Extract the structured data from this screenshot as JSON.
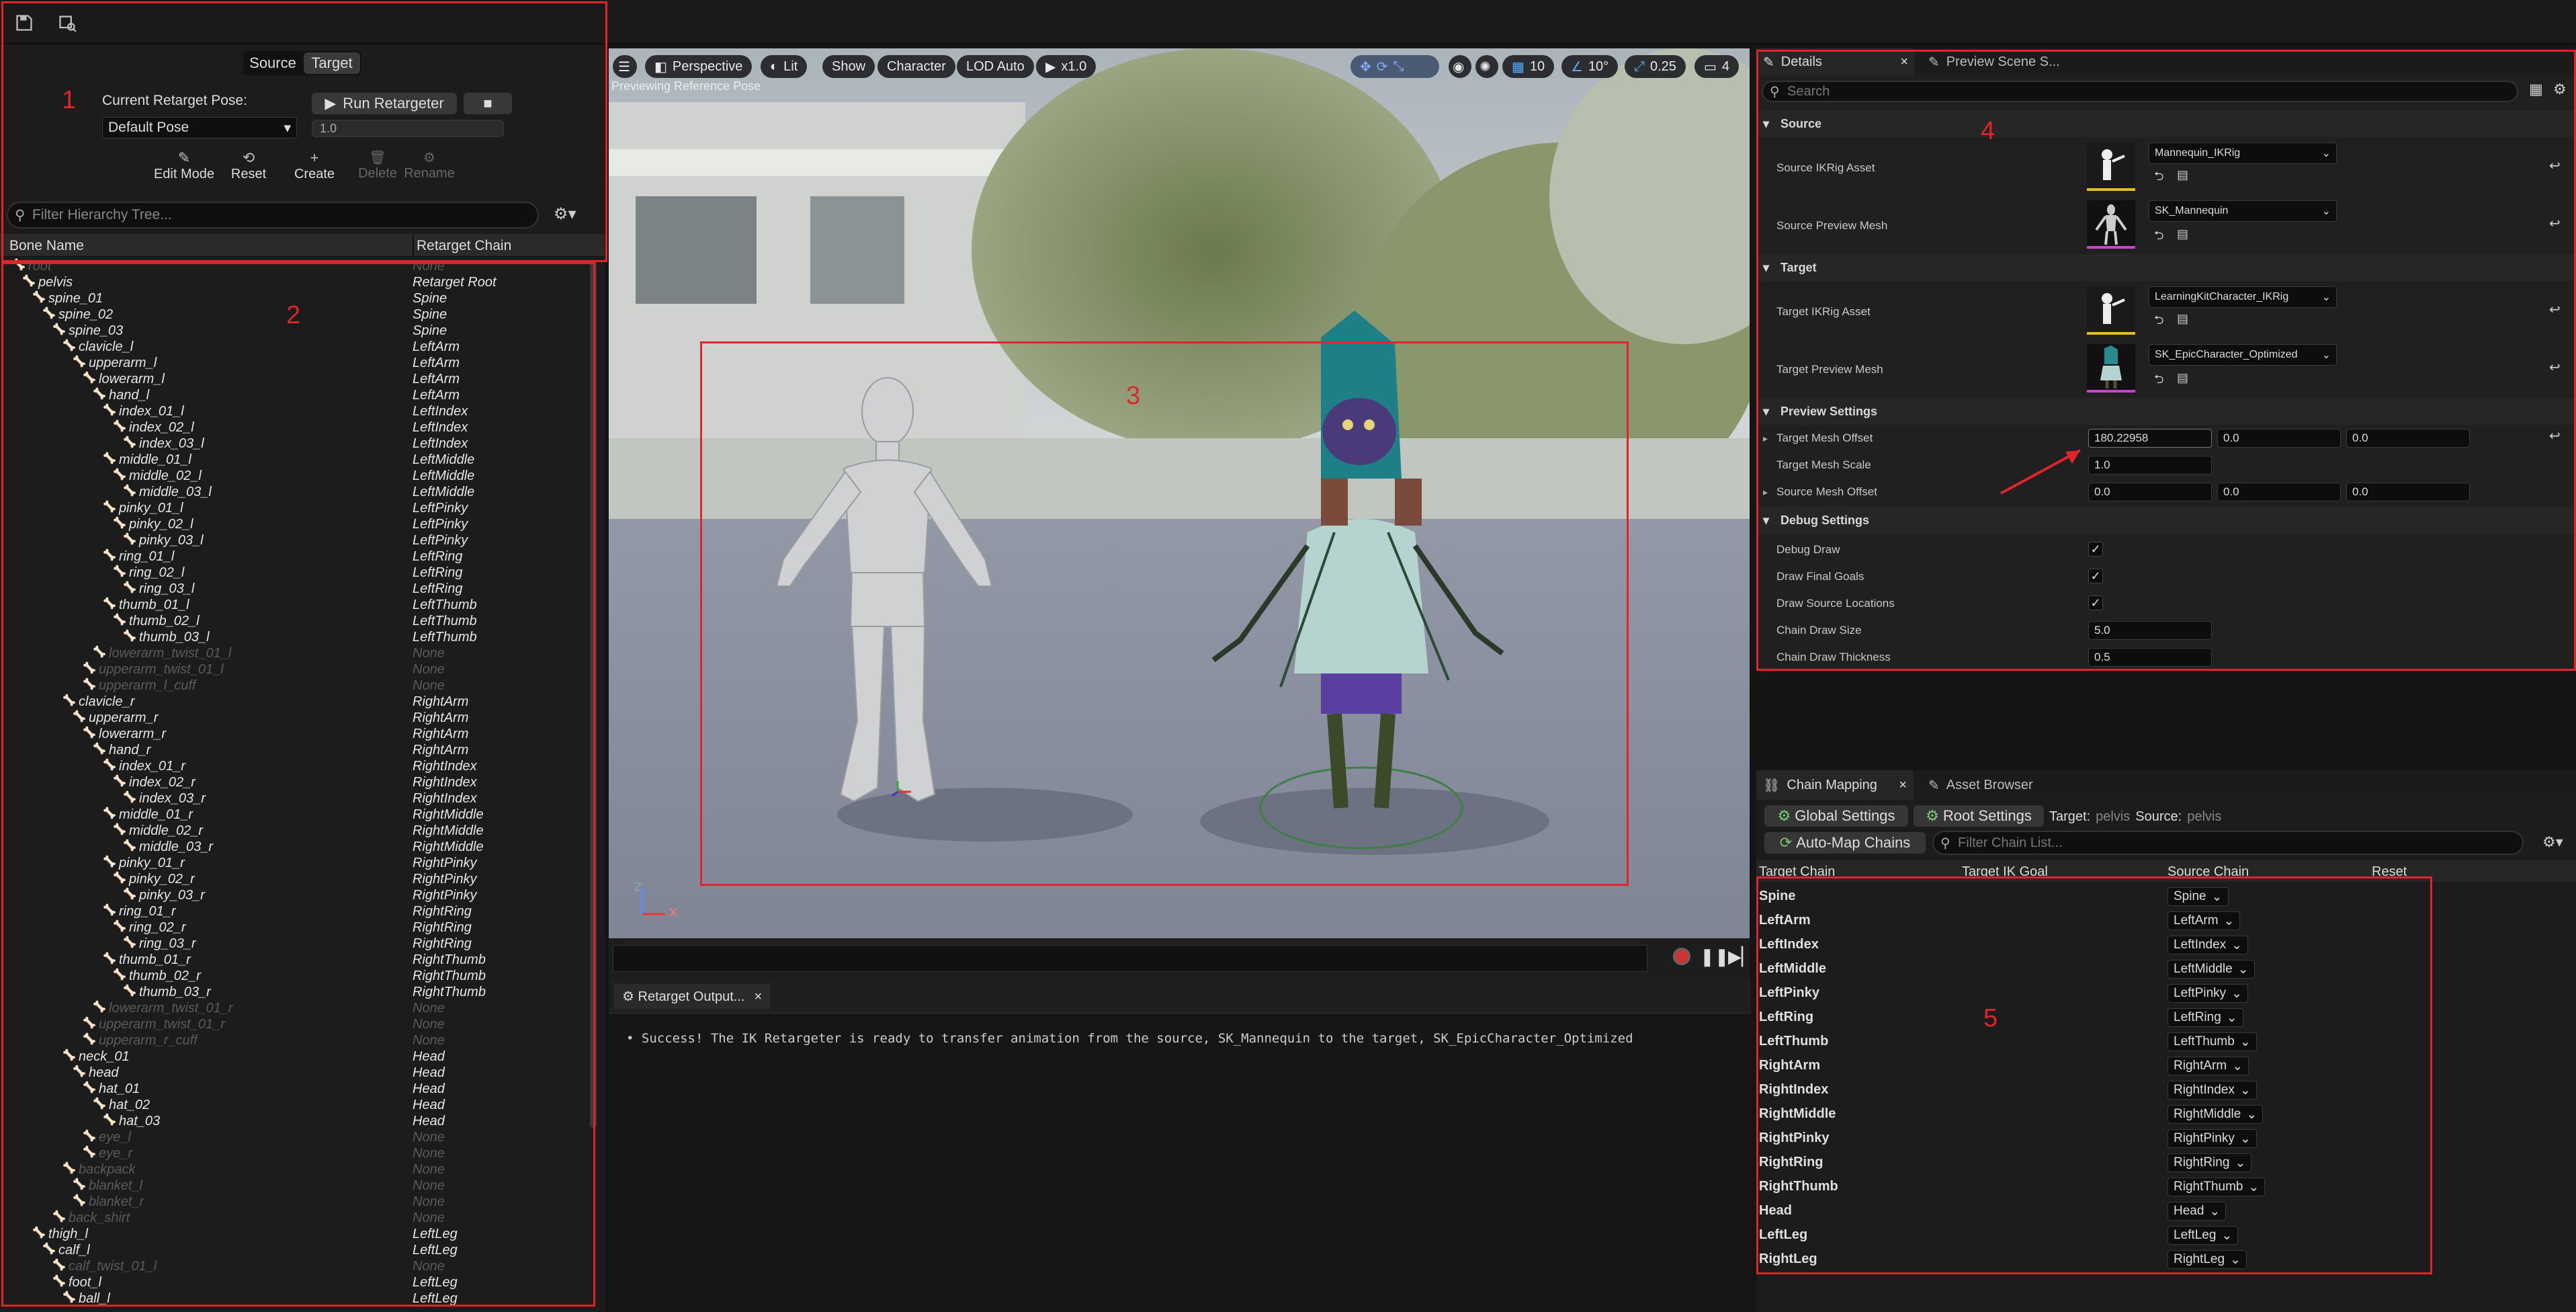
{
  "toolbar": {
    "save_icon": "save-icon",
    "browse_icon": "browse-asset-icon"
  },
  "retarget_panel": {
    "tab_source": "Source",
    "tab_target": "Target",
    "pose_label": "Current Retarget Pose:",
    "run_label": "Run Retargeter",
    "pose_value": "Default Pose",
    "blend_value": "1.0",
    "edit_mode": "Edit Mode",
    "reset": "Reset",
    "create": "Create",
    "delete": "Delete",
    "rename": "Rename",
    "filter_placeholder": "Filter Hierarchy Tree...",
    "col_bone": "Bone Name",
    "col_chain": "Retarget Chain"
  },
  "annotations": {
    "one": "1",
    "two": "2",
    "three": "3",
    "four": "4",
    "five": "5"
  },
  "bones": [
    {
      "name": "root",
      "chain": "None",
      "depth": 0,
      "dim": true
    },
    {
      "name": "pelvis",
      "chain": "Retarget Root",
      "depth": 1,
      "dim": false
    },
    {
      "name": "spine_01",
      "chain": "Spine",
      "depth": 2,
      "dim": false
    },
    {
      "name": "spine_02",
      "chain": "Spine",
      "depth": 3,
      "dim": false
    },
    {
      "name": "spine_03",
      "chain": "Spine",
      "depth": 4,
      "dim": false
    },
    {
      "name": "clavicle_l",
      "chain": "LeftArm",
      "depth": 5,
      "dim": false
    },
    {
      "name": "upperarm_l",
      "chain": "LeftArm",
      "depth": 6,
      "dim": false
    },
    {
      "name": "lowerarm_l",
      "chain": "LeftArm",
      "depth": 7,
      "dim": false
    },
    {
      "name": "hand_l",
      "chain": "LeftArm",
      "depth": 8,
      "dim": false
    },
    {
      "name": "index_01_l",
      "chain": "LeftIndex",
      "depth": 9,
      "dim": false
    },
    {
      "name": "index_02_l",
      "chain": "LeftIndex",
      "depth": 10,
      "dim": false
    },
    {
      "name": "index_03_l",
      "chain": "LeftIndex",
      "depth": 11,
      "dim": false
    },
    {
      "name": "middle_01_l",
      "chain": "LeftMiddle",
      "depth": 9,
      "dim": false
    },
    {
      "name": "middle_02_l",
      "chain": "LeftMiddle",
      "depth": 10,
      "dim": false
    },
    {
      "name": "middle_03_l",
      "chain": "LeftMiddle",
      "depth": 11,
      "dim": false
    },
    {
      "name": "pinky_01_l",
      "chain": "LeftPinky",
      "depth": 9,
      "dim": false
    },
    {
      "name": "pinky_02_l",
      "chain": "LeftPinky",
      "depth": 10,
      "dim": false
    },
    {
      "name": "pinky_03_l",
      "chain": "LeftPinky",
      "depth": 11,
      "dim": false
    },
    {
      "name": "ring_01_l",
      "chain": "LeftRing",
      "depth": 9,
      "dim": false
    },
    {
      "name": "ring_02_l",
      "chain": "LeftRing",
      "depth": 10,
      "dim": false
    },
    {
      "name": "ring_03_l",
      "chain": "LeftRing",
      "depth": 11,
      "dim": false
    },
    {
      "name": "thumb_01_l",
      "chain": "LeftThumb",
      "depth": 9,
      "dim": false
    },
    {
      "name": "thumb_02_l",
      "chain": "LeftThumb",
      "depth": 10,
      "dim": false
    },
    {
      "name": "thumb_03_l",
      "chain": "LeftThumb",
      "depth": 11,
      "dim": false
    },
    {
      "name": "lowerarm_twist_01_l",
      "chain": "None",
      "depth": 8,
      "dim": true
    },
    {
      "name": "upperarm_twist_01_l",
      "chain": "None",
      "depth": 7,
      "dim": true
    },
    {
      "name": "upperarm_l_cuff",
      "chain": "None",
      "depth": 7,
      "dim": true
    },
    {
      "name": "clavicle_r",
      "chain": "RightArm",
      "depth": 5,
      "dim": false
    },
    {
      "name": "upperarm_r",
      "chain": "RightArm",
      "depth": 6,
      "dim": false
    },
    {
      "name": "lowerarm_r",
      "chain": "RightArm",
      "depth": 7,
      "dim": false
    },
    {
      "name": "hand_r",
      "chain": "RightArm",
      "depth": 8,
      "dim": false
    },
    {
      "name": "index_01_r",
      "chain": "RightIndex",
      "depth": 9,
      "dim": false
    },
    {
      "name": "index_02_r",
      "chain": "RightIndex",
      "depth": 10,
      "dim": false
    },
    {
      "name": "index_03_r",
      "chain": "RightIndex",
      "depth": 11,
      "dim": false
    },
    {
      "name": "middle_01_r",
      "chain": "RightMiddle",
      "depth": 9,
      "dim": false
    },
    {
      "name": "middle_02_r",
      "chain": "RightMiddle",
      "depth": 10,
      "dim": false
    },
    {
      "name": "middle_03_r",
      "chain": "RightMiddle",
      "depth": 11,
      "dim": false
    },
    {
      "name": "pinky_01_r",
      "chain": "RightPinky",
      "depth": 9,
      "dim": false
    },
    {
      "name": "pinky_02_r",
      "chain": "RightPinky",
      "depth": 10,
      "dim": false
    },
    {
      "name": "pinky_03_r",
      "chain": "RightPinky",
      "depth": 11,
      "dim": false
    },
    {
      "name": "ring_01_r",
      "chain": "RightRing",
      "depth": 9,
      "dim": false
    },
    {
      "name": "ring_02_r",
      "chain": "RightRing",
      "depth": 10,
      "dim": false
    },
    {
      "name": "ring_03_r",
      "chain": "RightRing",
      "depth": 11,
      "dim": false
    },
    {
      "name": "thumb_01_r",
      "chain": "RightThumb",
      "depth": 9,
      "dim": false
    },
    {
      "name": "thumb_02_r",
      "chain": "RightThumb",
      "depth": 10,
      "dim": false
    },
    {
      "name": "thumb_03_r",
      "chain": "RightThumb",
      "depth": 11,
      "dim": false
    },
    {
      "name": "lowerarm_twist_01_r",
      "chain": "None",
      "depth": 8,
      "dim": true
    },
    {
      "name": "upperarm_twist_01_r",
      "chain": "None",
      "depth": 7,
      "dim": true
    },
    {
      "name": "upperarm_r_cuff",
      "chain": "None",
      "depth": 7,
      "dim": true
    },
    {
      "name": "neck_01",
      "chain": "Head",
      "depth": 5,
      "dim": false
    },
    {
      "name": "head",
      "chain": "Head",
      "depth": 6,
      "dim": false
    },
    {
      "name": "hat_01",
      "chain": "Head",
      "depth": 7,
      "dim": false
    },
    {
      "name": "hat_02",
      "chain": "Head",
      "depth": 8,
      "dim": false
    },
    {
      "name": "hat_03",
      "chain": "Head",
      "depth": 9,
      "dim": false
    },
    {
      "name": "eye_l",
      "chain": "None",
      "depth": 7,
      "dim": true
    },
    {
      "name": "eye_r",
      "chain": "None",
      "depth": 7,
      "dim": true
    },
    {
      "name": "backpack",
      "chain": "None",
      "depth": 5,
      "dim": true
    },
    {
      "name": "blanket_l",
      "chain": "None",
      "depth": 6,
      "dim": true
    },
    {
      "name": "blanket_r",
      "chain": "None",
      "depth": 6,
      "dim": true
    },
    {
      "name": "back_shirt",
      "chain": "None",
      "depth": 4,
      "dim": true
    },
    {
      "name": "thigh_l",
      "chain": "LeftLeg",
      "depth": 2,
      "dim": false
    },
    {
      "name": "calf_l",
      "chain": "LeftLeg",
      "depth": 3,
      "dim": false
    },
    {
      "name": "calf_twist_01_l",
      "chain": "None",
      "depth": 4,
      "dim": true
    },
    {
      "name": "foot_l",
      "chain": "LeftLeg",
      "depth": 4,
      "dim": false
    },
    {
      "name": "ball_l",
      "chain": "LeftLeg",
      "depth": 5,
      "dim": false
    }
  ],
  "viewport": {
    "perspective": "Perspective",
    "lit": "Lit",
    "show": "Show",
    "character": "Character",
    "lod": "LOD Auto",
    "speed": "x1.0",
    "status": "Previewing Reference Pose",
    "grid": "10",
    "angle": "10°",
    "scale": "0.25",
    "cams": "4",
    "axis_z": "Z",
    "axis_x": "X"
  },
  "details": {
    "tab": "Details",
    "tab2": "Preview Scene S...",
    "search_placeholder": "Search",
    "sec_source": "Source",
    "sec_target": "Target",
    "sec_preview": "Preview Settings",
    "sec_debug": "Debug Settings",
    "source_ikrig_label": "Source IKRig Asset",
    "source_ikrig_value": "Mannequin_IKRig",
    "source_mesh_label": "Source Preview Mesh",
    "source_mesh_value": "SK_Mannequin",
    "target_ikrig_label": "Target IKRig Asset",
    "target_ikrig_value": "LearningKitCharacter_IKRig",
    "target_mesh_label": "Target Preview Mesh",
    "target_mesh_value": "SK_EpicCharacter_Optimized",
    "tmo_label": "Target Mesh Offset",
    "tmo_x": "180.22958",
    "tmo_y": "0.0",
    "tmo_z": "0.0",
    "tms_label": "Target Mesh Scale",
    "tms_value": "1.0",
    "smo_label": "Source Mesh Offset",
    "smo_x": "0.0",
    "smo_y": "0.0",
    "smo_z": "0.0",
    "debug_draw": "Debug Draw",
    "draw_goals": "Draw Final Goals",
    "draw_src": "Draw Source Locations",
    "chain_size_label": "Chain Draw Size",
    "chain_size": "5.0",
    "chain_thick_label": "Chain Draw Thickness",
    "chain_thick": "0.5"
  },
  "chain_mapping": {
    "tab": "Chain Mapping",
    "tab2": "Asset Browser",
    "global": "Global Settings",
    "root": "Root Settings",
    "target_label": "Target:",
    "target_val": "pelvis",
    "source_label": "Source:",
    "source_val": "pelvis",
    "automap": "Auto-Map Chains",
    "filter_placeholder": "Filter Chain List...",
    "col_target": "Target Chain",
    "col_goal": "Target IK Goal",
    "col_source": "Source Chain",
    "col_reset": "Reset",
    "rows": [
      {
        "target": "Spine",
        "source": "Spine"
      },
      {
        "target": "LeftArm",
        "source": "LeftArm"
      },
      {
        "target": "LeftIndex",
        "source": "LeftIndex"
      },
      {
        "target": "LeftMiddle",
        "source": "LeftMiddle"
      },
      {
        "target": "LeftPinky",
        "source": "LeftPinky"
      },
      {
        "target": "LeftRing",
        "source": "LeftRing"
      },
      {
        "target": "LeftThumb",
        "source": "LeftThumb"
      },
      {
        "target": "RightArm",
        "source": "RightArm"
      },
      {
        "target": "RightIndex",
        "source": "RightIndex"
      },
      {
        "target": "RightMiddle",
        "source": "RightMiddle"
      },
      {
        "target": "RightPinky",
        "source": "RightPinky"
      },
      {
        "target": "RightRing",
        "source": "RightRing"
      },
      {
        "target": "RightThumb",
        "source": "RightThumb"
      },
      {
        "target": "Head",
        "source": "Head"
      },
      {
        "target": "LeftLeg",
        "source": "LeftLeg"
      },
      {
        "target": "RightLeg",
        "source": "RightLeg"
      }
    ]
  },
  "output_log": {
    "tab": "Retarget Output...",
    "message": "Success! The IK Retargeter is ready to transfer animation from the source, SK_Mannequin to the target, SK_EpicCharacter_Optimized"
  },
  "colors": {
    "accent": "#e0242b",
    "highlight": "#e8a010"
  }
}
